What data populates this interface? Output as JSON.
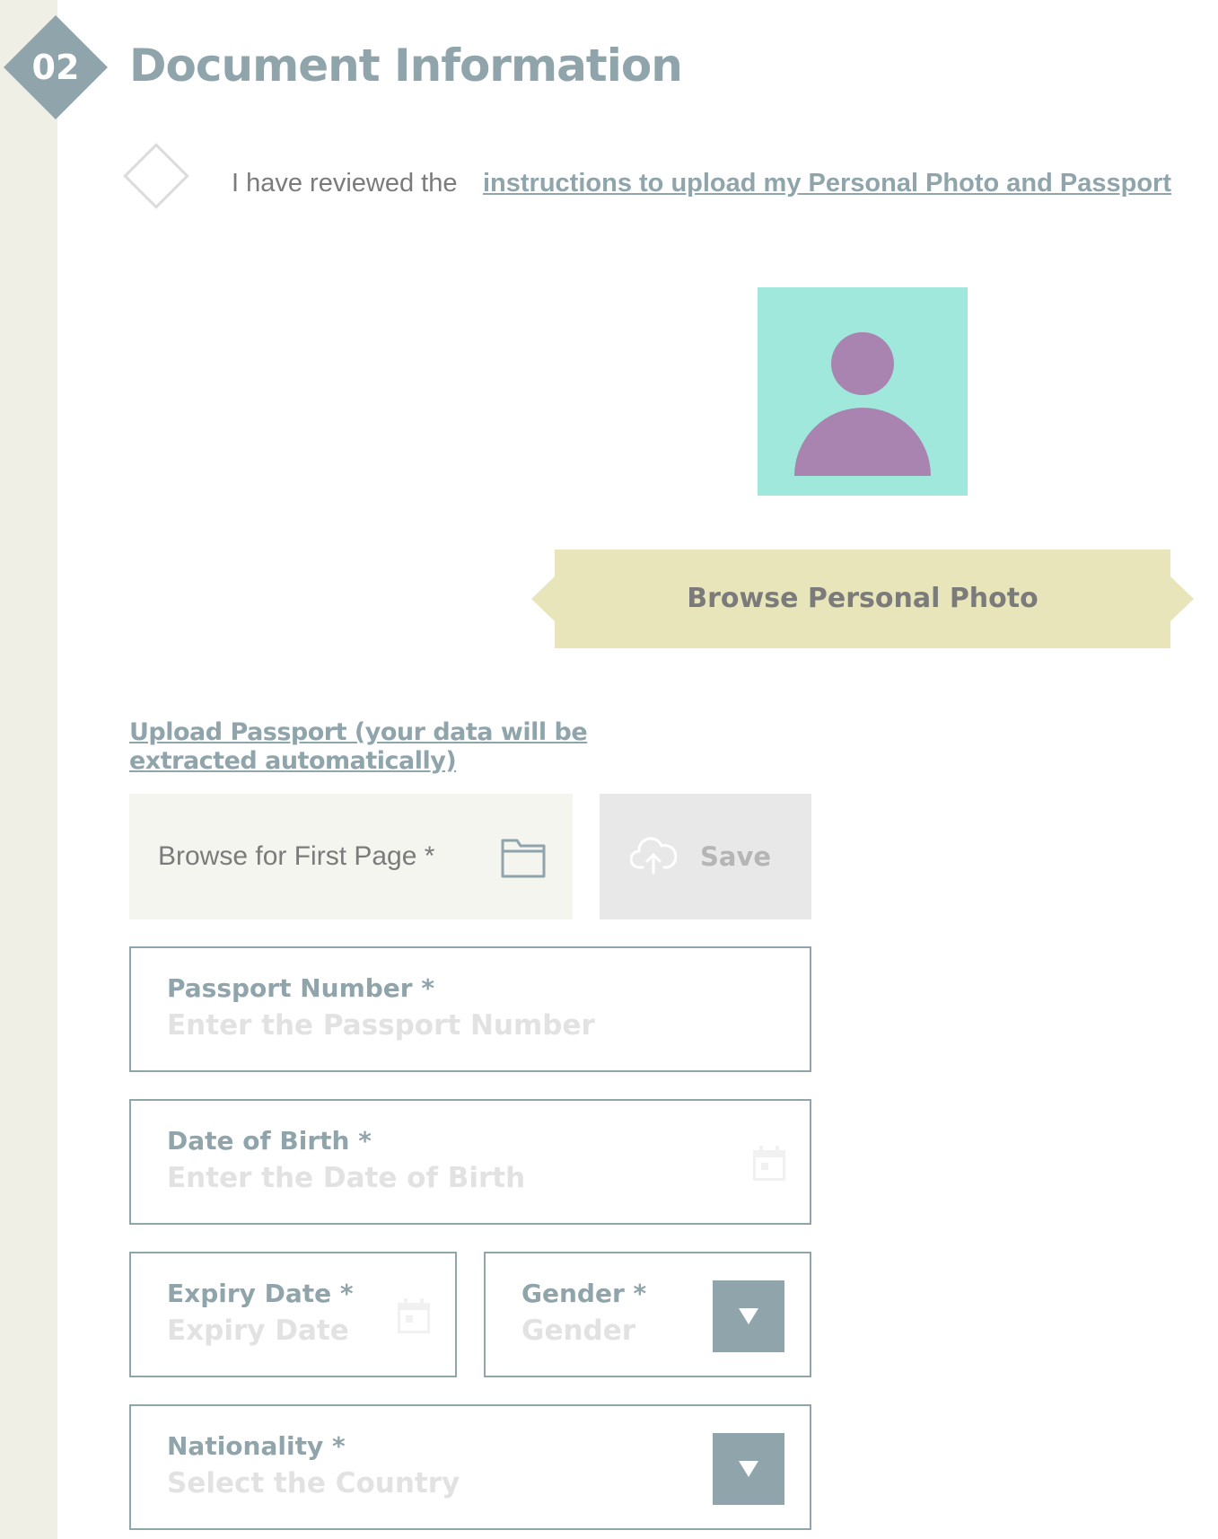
{
  "section": {
    "step_number": "02",
    "title": "Document Information"
  },
  "consent": {
    "text": "I have reviewed the",
    "link_text": "instructions to upload my Personal Photo and Passport"
  },
  "photo": {
    "browse_label": "Browse Personal Photo",
    "avatar_icon": "person-icon"
  },
  "passport_upload": {
    "link_text": "Upload Passport (your data will be extracted automatically)",
    "browse_label": "Browse for First Page *",
    "save_label": "Save"
  },
  "fields": {
    "passport_number": {
      "label": "Passport Number *",
      "placeholder": "Enter the Passport Number"
    },
    "date_of_birth": {
      "label": "Date of Birth *",
      "placeholder": "Enter the Date of Birth"
    },
    "expiry_date": {
      "label": "Expiry Date *",
      "placeholder": "Expiry Date"
    },
    "gender": {
      "label": "Gender *",
      "placeholder": "Gender"
    },
    "nationality": {
      "label": "Nationality *",
      "placeholder": "Select the Country"
    }
  },
  "colors": {
    "accent": "#8fa4ab",
    "rail": "#efefe6",
    "photo_bg": "#a0e8dc",
    "avatar": "#aa84b0",
    "ribbon": "#e8e5ba",
    "placeholder": "#e2e2e2",
    "text": "#7b7b7b"
  }
}
